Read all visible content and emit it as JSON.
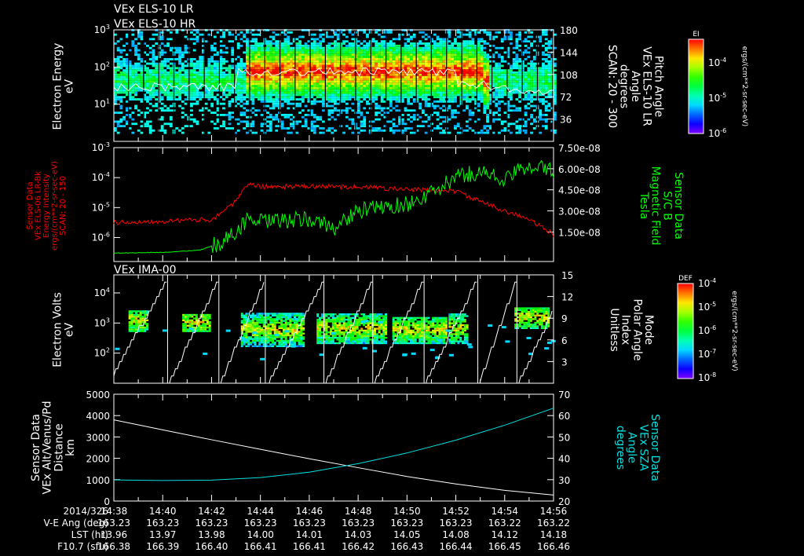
{
  "chart_data": [
    {
      "type": "heatmap",
      "titles": [
        "VEx ELS-10 LR",
        "VEx ELS-10 HR"
      ],
      "ylabel": [
        "Electron Energy",
        "eV"
      ],
      "yticks": [
        "10^0",
        "10^1",
        "10^2",
        "10^3"
      ],
      "ylim_log": [
        0,
        3
      ],
      "y2label": [
        "Pitch Angle",
        "VEx ELS-10 LR",
        "Angle",
        "degrees",
        "SCAN: 20 - 300"
      ],
      "y2ticks": [
        36,
        72,
        108,
        144,
        180
      ],
      "y2lim": [
        0,
        180
      ],
      "colorbar": {
        "title": "EI",
        "ticks": [
          "10^-4",
          "10^-5",
          "10^-6"
        ],
        "units": "ergs/(cm**2-sr-sec-eV)"
      },
      "pitch_angle_line": {
        "x": [
          14.633,
          14.7,
          14.75,
          14.8,
          14.85,
          14.9,
          14.95,
          15.0
        ],
        "y": [
          85,
          100,
          112,
          112,
          108,
          110,
          100,
          80
        ]
      }
    },
    {
      "type": "line",
      "ylabel": [
        "Sensor Data",
        "VEx ELS-06 LR-Bk",
        "Energy Intensity",
        "ergs/(cm**2-sr-sec-eV)",
        "SCAN: 20 - 150"
      ],
      "yticks": [
        "10^-6",
        "10^-5",
        "10^-4",
        "10^-3"
      ],
      "ylim_log": [
        -6.8,
        -3
      ],
      "y2label": [
        "Sensor Data",
        "S/C B",
        "Magnetic Field",
        "Tesla"
      ],
      "y2ticks": [
        "1.50e-08",
        "3.00e-08",
        "4.50e-08",
        "6.00e-08",
        "7.50e-08"
      ],
      "y2lim": [
        -6e-09,
        7.5e-08
      ],
      "series": [
        {
          "name": "Energy Intensity",
          "color": "#ff0000",
          "axis": "left",
          "x": [
            38,
            40,
            42,
            43,
            43.5,
            44,
            46,
            48,
            50,
            52,
            53,
            54,
            55,
            56
          ],
          "y": [
            -5.5,
            -5.45,
            -5.4,
            -4.8,
            -4.2,
            -4.3,
            -4.3,
            -4.3,
            -4.4,
            -4.45,
            -4.8,
            -5.1,
            -5.4,
            -5.9
          ]
        },
        {
          "name": "Magnetic Field",
          "color": "#00ff00",
          "axis": "right",
          "x": [
            38,
            40,
            41.5,
            42.5,
            43.5,
            44,
            46,
            47,
            48,
            50,
            51,
            52,
            53,
            54,
            55,
            56
          ],
          "y": [
            0.0,
            5e-10,
            2e-09,
            8e-09,
            2.4e-08,
            2.2e-08,
            2.4e-08,
            1.8e-08,
            3e-08,
            3.5e-08,
            4.2e-08,
            5.4e-08,
            5.8e-08,
            5.2e-08,
            6.3e-08,
            5.8e-08
          ]
        }
      ]
    },
    {
      "type": "heatmap",
      "title": "VEx IMA-00",
      "ylabel": [
        "Electron Volts",
        "eV"
      ],
      "yticks": [
        "10^2",
        "10^3",
        "10^4"
      ],
      "ylim_log": [
        1.0,
        4.6
      ],
      "y2label": [
        "Mode",
        "Polar Angle",
        "Index",
        "Unitless"
      ],
      "y2ticks": [
        3,
        6,
        9,
        12,
        15
      ],
      "y2lim": [
        0,
        15
      ],
      "colorbar": {
        "title": "DEF",
        "ticks": [
          "10^-4",
          "10^-5",
          "10^-6",
          "10^-7",
          "10^-8"
        ],
        "units": "ergs/(cm**2-sr-sec-eV)"
      }
    },
    {
      "type": "line",
      "ylabel": [
        "Sensor Data",
        "VEx Alt/Venus/Pd",
        "Distance",
        "km"
      ],
      "yticks": [
        "0",
        "1000",
        "2000",
        "3000",
        "4000",
        "5000"
      ],
      "ylim": [
        0,
        5000
      ],
      "y2label": [
        "Sensor Data",
        "VEx SZA",
        "Angle",
        "degrees"
      ],
      "y2ticks": [
        "20",
        "30",
        "40",
        "50",
        "60",
        "70"
      ],
      "y2lim": [
        20,
        70
      ],
      "series": [
        {
          "name": "Distance",
          "color": "#ffffff",
          "axis": "left",
          "x": [
            38,
            40,
            42,
            44,
            46,
            48,
            50,
            52,
            54,
            56
          ],
          "y": [
            3800,
            3330,
            2870,
            2420,
            1980,
            1560,
            1150,
            800,
            500,
            280
          ]
        },
        {
          "name": "SZA",
          "color": "#00e0e0",
          "axis": "right",
          "x": [
            38,
            40,
            42,
            44,
            46,
            48,
            50,
            52,
            54,
            56
          ],
          "y": [
            29.9,
            29.6,
            29.8,
            31,
            33.5,
            37.5,
            42.5,
            48.5,
            55.5,
            63.5
          ]
        }
      ]
    }
  ],
  "xaxis": {
    "rows": [
      {
        "label": "2014/326",
        "values": [
          "14:38",
          "14:40",
          "14:42",
          "14:44",
          "14:46",
          "14:48",
          "14:50",
          "14:52",
          "14:54",
          "14:56"
        ]
      },
      {
        "label": "V-E Ang (deg)",
        "values": [
          "163.23",
          "163.23",
          "163.23",
          "163.23",
          "163.23",
          "163.23",
          "163.23",
          "163.23",
          "163.22",
          "163.22"
        ]
      },
      {
        "label": "LST (hr)",
        "values": [
          "13.96",
          "13.97",
          "13.98",
          "14.00",
          "14.01",
          "14.03",
          "14.05",
          "14.08",
          "14.12",
          "14.18"
        ]
      },
      {
        "label": "F10.7 (sfu)",
        "values": [
          "166.38",
          "166.39",
          "166.40",
          "166.41",
          "166.41",
          "166.42",
          "166.43",
          "166.44",
          "166.45",
          "166.46"
        ]
      }
    ]
  }
}
